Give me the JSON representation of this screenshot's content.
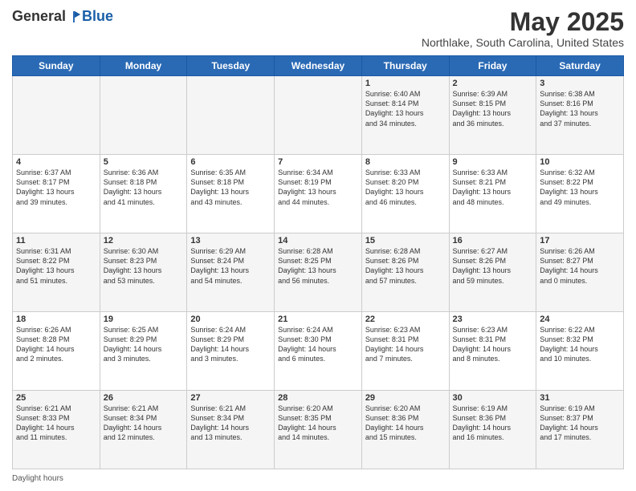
{
  "header": {
    "logo_general": "General",
    "logo_blue": "Blue",
    "month_title": "May 2025",
    "location": "Northlake, South Carolina, United States"
  },
  "weekdays": [
    "Sunday",
    "Monday",
    "Tuesday",
    "Wednesday",
    "Thursday",
    "Friday",
    "Saturday"
  ],
  "footer": {
    "daylight_label": "Daylight hours"
  },
  "weeks": [
    [
      {
        "day": "",
        "info": ""
      },
      {
        "day": "",
        "info": ""
      },
      {
        "day": "",
        "info": ""
      },
      {
        "day": "",
        "info": ""
      },
      {
        "day": "1",
        "info": "Sunrise: 6:40 AM\nSunset: 8:14 PM\nDaylight: 13 hours\nand 34 minutes."
      },
      {
        "day": "2",
        "info": "Sunrise: 6:39 AM\nSunset: 8:15 PM\nDaylight: 13 hours\nand 36 minutes."
      },
      {
        "day": "3",
        "info": "Sunrise: 6:38 AM\nSunset: 8:16 PM\nDaylight: 13 hours\nand 37 minutes."
      }
    ],
    [
      {
        "day": "4",
        "info": "Sunrise: 6:37 AM\nSunset: 8:17 PM\nDaylight: 13 hours\nand 39 minutes."
      },
      {
        "day": "5",
        "info": "Sunrise: 6:36 AM\nSunset: 8:18 PM\nDaylight: 13 hours\nand 41 minutes."
      },
      {
        "day": "6",
        "info": "Sunrise: 6:35 AM\nSunset: 8:18 PM\nDaylight: 13 hours\nand 43 minutes."
      },
      {
        "day": "7",
        "info": "Sunrise: 6:34 AM\nSunset: 8:19 PM\nDaylight: 13 hours\nand 44 minutes."
      },
      {
        "day": "8",
        "info": "Sunrise: 6:33 AM\nSunset: 8:20 PM\nDaylight: 13 hours\nand 46 minutes."
      },
      {
        "day": "9",
        "info": "Sunrise: 6:33 AM\nSunset: 8:21 PM\nDaylight: 13 hours\nand 48 minutes."
      },
      {
        "day": "10",
        "info": "Sunrise: 6:32 AM\nSunset: 8:22 PM\nDaylight: 13 hours\nand 49 minutes."
      }
    ],
    [
      {
        "day": "11",
        "info": "Sunrise: 6:31 AM\nSunset: 8:22 PM\nDaylight: 13 hours\nand 51 minutes."
      },
      {
        "day": "12",
        "info": "Sunrise: 6:30 AM\nSunset: 8:23 PM\nDaylight: 13 hours\nand 53 minutes."
      },
      {
        "day": "13",
        "info": "Sunrise: 6:29 AM\nSunset: 8:24 PM\nDaylight: 13 hours\nand 54 minutes."
      },
      {
        "day": "14",
        "info": "Sunrise: 6:28 AM\nSunset: 8:25 PM\nDaylight: 13 hours\nand 56 minutes."
      },
      {
        "day": "15",
        "info": "Sunrise: 6:28 AM\nSunset: 8:26 PM\nDaylight: 13 hours\nand 57 minutes."
      },
      {
        "day": "16",
        "info": "Sunrise: 6:27 AM\nSunset: 8:26 PM\nDaylight: 13 hours\nand 59 minutes."
      },
      {
        "day": "17",
        "info": "Sunrise: 6:26 AM\nSunset: 8:27 PM\nDaylight: 14 hours\nand 0 minutes."
      }
    ],
    [
      {
        "day": "18",
        "info": "Sunrise: 6:26 AM\nSunset: 8:28 PM\nDaylight: 14 hours\nand 2 minutes."
      },
      {
        "day": "19",
        "info": "Sunrise: 6:25 AM\nSunset: 8:29 PM\nDaylight: 14 hours\nand 3 minutes."
      },
      {
        "day": "20",
        "info": "Sunrise: 6:24 AM\nSunset: 8:29 PM\nDaylight: 14 hours\nand 3 minutes."
      },
      {
        "day": "21",
        "info": "Sunrise: 6:24 AM\nSunset: 8:30 PM\nDaylight: 14 hours\nand 6 minutes."
      },
      {
        "day": "22",
        "info": "Sunrise: 6:23 AM\nSunset: 8:31 PM\nDaylight: 14 hours\nand 7 minutes."
      },
      {
        "day": "23",
        "info": "Sunrise: 6:23 AM\nSunset: 8:31 PM\nDaylight: 14 hours\nand 8 minutes."
      },
      {
        "day": "24",
        "info": "Sunrise: 6:22 AM\nSunset: 8:32 PM\nDaylight: 14 hours\nand 10 minutes."
      }
    ],
    [
      {
        "day": "25",
        "info": "Sunrise: 6:21 AM\nSunset: 8:33 PM\nDaylight: 14 hours\nand 11 minutes."
      },
      {
        "day": "26",
        "info": "Sunrise: 6:21 AM\nSunset: 8:34 PM\nDaylight: 14 hours\nand 12 minutes."
      },
      {
        "day": "27",
        "info": "Sunrise: 6:21 AM\nSunset: 8:34 PM\nDaylight: 14 hours\nand 13 minutes."
      },
      {
        "day": "28",
        "info": "Sunrise: 6:20 AM\nSunset: 8:35 PM\nDaylight: 14 hours\nand 14 minutes."
      },
      {
        "day": "29",
        "info": "Sunrise: 6:20 AM\nSunset: 8:36 PM\nDaylight: 14 hours\nand 15 minutes."
      },
      {
        "day": "30",
        "info": "Sunrise: 6:19 AM\nSunset: 8:36 PM\nDaylight: 14 hours\nand 16 minutes."
      },
      {
        "day": "31",
        "info": "Sunrise: 6:19 AM\nSunset: 8:37 PM\nDaylight: 14 hours\nand 17 minutes."
      }
    ]
  ]
}
